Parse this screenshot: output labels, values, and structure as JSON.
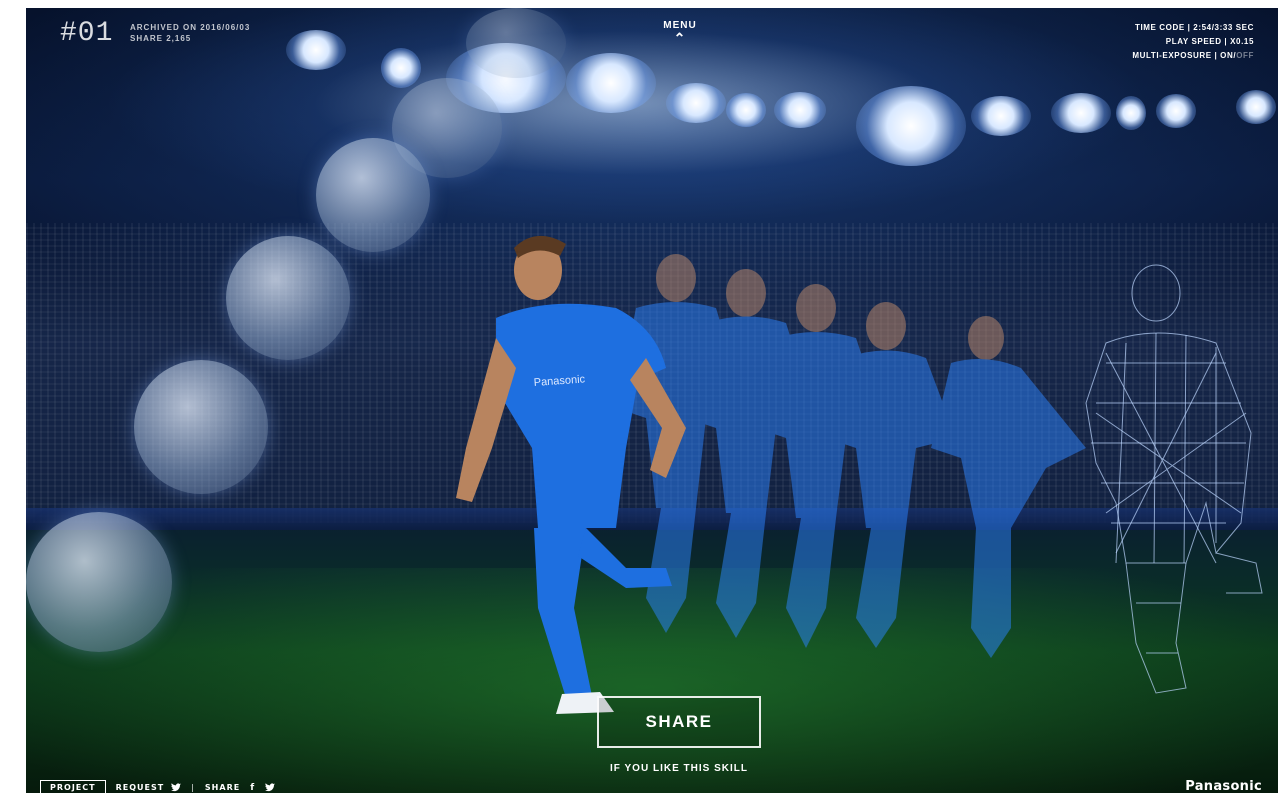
{
  "hud": {
    "clip_number": "#01",
    "archived": "ARCHIVED ON 2016/06/03",
    "share_count": "SHARE 2,165",
    "menu_label": "MENU",
    "time_code": "TIME CODE | 2:54/3:33 SEC",
    "play_speed": "PLAY SPEED | X0.15",
    "multi_exposure_label": "MULTI-EXPOSURE | ON/",
    "multi_exposure_off": "OFF"
  },
  "cta": {
    "share_label": "SHARE",
    "subtitle": "IF YOU LIKE THIS SKILL"
  },
  "footer": {
    "project_label": "PROJECT",
    "request_label": "REQUEST",
    "share_label": "SHARE",
    "separator": "|",
    "brand": "Panasonic"
  },
  "colors": {
    "jersey": "#1e6fe0",
    "stadium_night": "#0a1a3c",
    "pitch": "#0c3a1c"
  },
  "icons": [
    "chevron-up-icon",
    "twitter-icon",
    "facebook-icon"
  ]
}
